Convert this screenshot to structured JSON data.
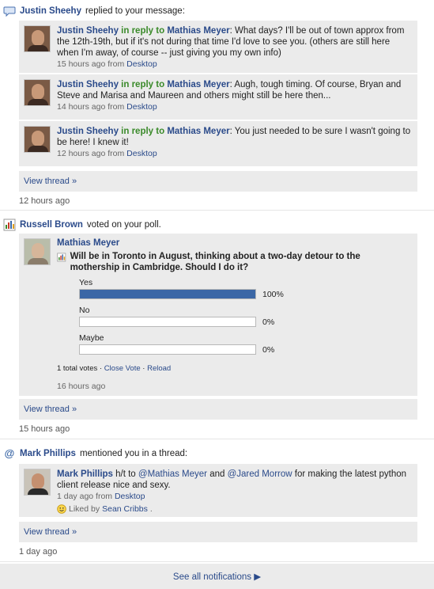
{
  "notifications": [
    {
      "actor": "Justin Sheehy",
      "action": "replied to your message:",
      "messages": [
        {
          "name": "Justin Sheehy",
          "in_reply_to": "in reply to",
          "target": "Mathias Meyer",
          "text": ": What days? I'll be out of town approx from the 12th-19th, but if it's not during that time I'd love to see you. (others are still here when I'm away, of course -- just giving you my own info)",
          "time": "15 hours ago from",
          "source": "Desktop"
        },
        {
          "name": "Justin Sheehy",
          "in_reply_to": "in reply to",
          "target": "Mathias Meyer",
          "text": ": Augh, tough timing. Of course, Bryan and Steve and Marisa and Maureen and others might still be here then...",
          "time": "14 hours ago from",
          "source": "Desktop"
        },
        {
          "name": "Justin Sheehy",
          "in_reply_to": "in reply to",
          "target": "Mathias Meyer",
          "text": ": You just needed to be sure I wasn't going to be here! I knew it!",
          "time": "12 hours ago from",
          "source": "Desktop"
        }
      ],
      "view_thread": "View thread »",
      "ago": "12 hours ago"
    },
    {
      "actor": "Russell Brown",
      "action": "voted on your poll.",
      "poll": {
        "author": "Mathias Meyer",
        "question": "Will be in Toronto in August, thinking about a two-day detour to the mothership in Cambridge. Should I do it?",
        "options": [
          {
            "label": "Yes",
            "percent_text": "100%",
            "fraction": 1.0
          },
          {
            "label": "No",
            "percent_text": "0%",
            "fraction": 0.0
          },
          {
            "label": "Maybe",
            "percent_text": "0%",
            "fraction": 0.0
          }
        ],
        "total_votes": "1 total votes",
        "close_vote": "Close Vote",
        "reload": "Reload",
        "time": "16 hours ago"
      },
      "view_thread": "View thread »",
      "ago": "15 hours ago"
    },
    {
      "actor": "Mark Phillips",
      "action": "mentioned you in a thread:",
      "message": {
        "name": "Mark Phillips",
        "pre": " h/t to ",
        "mention1": "@Mathias Meyer",
        "mid": " and ",
        "mention2": "@Jared Morrow",
        "post": " for making the latest python client release nice and sexy.",
        "time": "1 day ago from",
        "source": "Desktop",
        "liked_prefix": "Liked by",
        "liked_by": "Sean Cribbs",
        "liked_suffix": "."
      },
      "view_thread": "View thread »",
      "ago": "1 day ago"
    }
  ],
  "footer": {
    "see_all": "See all notifications ▶"
  },
  "colors": {
    "link": "#2a4a8a",
    "in_reply": "#3a8a2a",
    "poll_bar": "#3b67a6",
    "card_bg": "#ebebeb"
  }
}
